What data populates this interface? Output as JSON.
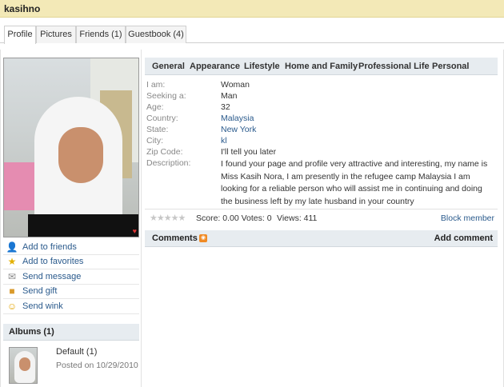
{
  "header": {
    "username": "kasihno"
  },
  "tabs": [
    {
      "label": "Profile"
    },
    {
      "label": "Pictures"
    },
    {
      "label": "Friends (1)"
    },
    {
      "label": "Guestbook (4)"
    }
  ],
  "actions": [
    {
      "label": "Add to friends",
      "icon": "add-friend-icon"
    },
    {
      "label": "Add to favorites",
      "icon": "star-icon"
    },
    {
      "label": "Send message",
      "icon": "envelope-icon"
    },
    {
      "label": "Send gift",
      "icon": "gift-icon"
    },
    {
      "label": "Send wink",
      "icon": "smiley-icon"
    }
  ],
  "albums": {
    "heading": "Albums (1)",
    "items": [
      {
        "name": "Default (1)",
        "date": "Posted on 10/29/2010"
      }
    ]
  },
  "categories": [
    "General",
    "Appearance",
    "Lifestyle",
    "Home and Family",
    "Professional Life",
    "Personal"
  ],
  "fields": {
    "iam": {
      "label": "I am:",
      "value": "Woman"
    },
    "seeking": {
      "label": "Seeking a:",
      "value": "Man"
    },
    "age": {
      "label": "Age:",
      "value": "32"
    },
    "country": {
      "label": "Country:",
      "value": "Malaysia"
    },
    "state": {
      "label": "State:",
      "value": "New York"
    },
    "city": {
      "label": "City:",
      "value": "kl"
    },
    "zip": {
      "label": "Zip Code:",
      "value": "I'll tell you later"
    },
    "description": {
      "label": "Description:",
      "value": "I found your page and profile very attractive and interesting, my name is Miss Kasih Nora, I am presently in the refugee camp Malaysia I am looking for a reliable person who will assist me in continuing and doing the business left by my late husband in your country"
    }
  },
  "rating": {
    "stars": "★★★★★",
    "score_text": "Score: 0.00 Votes: 0",
    "views_text": "Views: 411",
    "block_label": "Block member"
  },
  "comments": {
    "heading": "Comments",
    "add_label": "Add comment"
  },
  "colors": {
    "title_bar": "#f3e9b7",
    "section_header": "#e7ecf0",
    "link": "#2a5a8c",
    "rss": "#f08a24"
  }
}
